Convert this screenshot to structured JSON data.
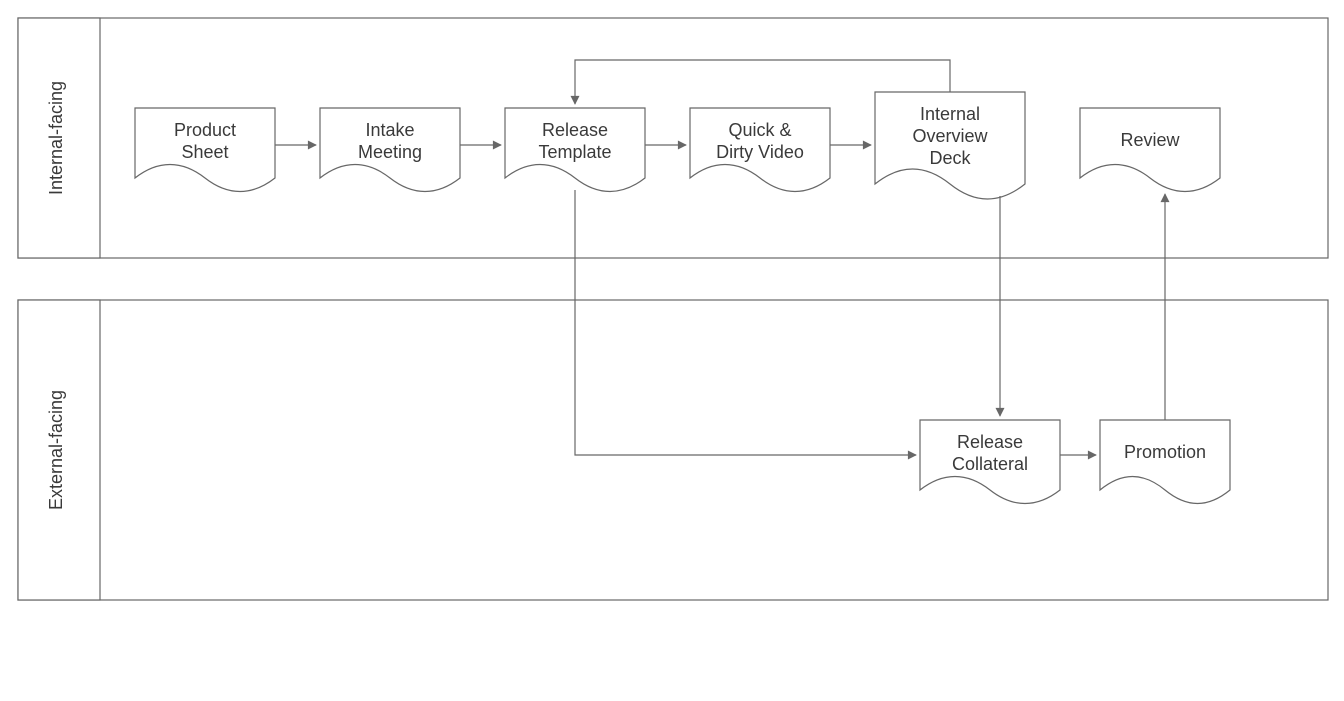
{
  "lanes": {
    "internal": {
      "label": "Internal-facing"
    },
    "external": {
      "label": "External-facing"
    }
  },
  "nodes": {
    "product_sheet": {
      "line1": "Product",
      "line2": "Sheet"
    },
    "intake_meeting": {
      "line1": "Intake",
      "line2": "Meeting"
    },
    "release_template": {
      "line1": "Release",
      "line2": "Template"
    },
    "quick_dirty": {
      "line1": "Quick &",
      "line2": "Dirty Video"
    },
    "overview_deck": {
      "line1": "Internal",
      "line2": "Overview",
      "line3": "Deck"
    },
    "review": {
      "line1": "Review"
    },
    "release_collateral": {
      "line1": "Release",
      "line2": "Collateral"
    },
    "promotion": {
      "line1": "Promotion"
    }
  },
  "diagram": {
    "type": "swimlane-flowchart",
    "lanes": [
      "Internal-facing",
      "External-facing"
    ],
    "flow": [
      {
        "from": "Product Sheet",
        "to": "Intake Meeting",
        "lane": "Internal-facing"
      },
      {
        "from": "Intake Meeting",
        "to": "Release Template",
        "lane": "Internal-facing"
      },
      {
        "from": "Release Template",
        "to": "Quick & Dirty Video",
        "lane": "Internal-facing"
      },
      {
        "from": "Quick & Dirty Video",
        "to": "Internal Overview Deck",
        "lane": "Internal-facing"
      },
      {
        "from": "Internal Overview Deck",
        "to": "Release Template",
        "lane": "Internal-facing",
        "note": "feedback loop"
      },
      {
        "from": "Release Template",
        "to": "Release Collateral",
        "lane": "External-facing"
      },
      {
        "from": "Internal Overview Deck",
        "to": "Release Collateral",
        "lane": "External-facing"
      },
      {
        "from": "Release Collateral",
        "to": "Promotion",
        "lane": "External-facing"
      },
      {
        "from": "Promotion",
        "to": "Review",
        "lane": "Internal-facing"
      }
    ]
  }
}
